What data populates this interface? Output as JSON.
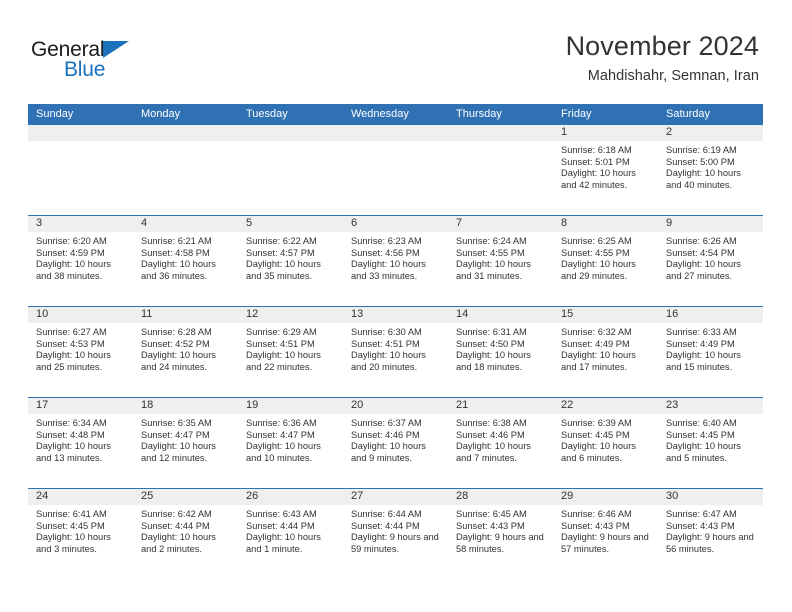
{
  "logo": {
    "word_top": "General",
    "word_bottom": "Blue",
    "triangle_color": "#1a72bd"
  },
  "header": {
    "title": "November 2024",
    "subtitle": "Mahdishahr, Semnan, Iran"
  },
  "theme": {
    "accent": "#3071b3",
    "day_band": "#efefef",
    "text": "#333333"
  },
  "weekdays": [
    "Sunday",
    "Monday",
    "Tuesday",
    "Wednesday",
    "Thursday",
    "Friday",
    "Saturday"
  ],
  "weeks": [
    [
      {
        "day": "",
        "empty": true
      },
      {
        "day": "",
        "empty": true
      },
      {
        "day": "",
        "empty": true
      },
      {
        "day": "",
        "empty": true
      },
      {
        "day": "",
        "empty": true
      },
      {
        "day": "1",
        "sunrise": "Sunrise: 6:18 AM",
        "sunset": "Sunset: 5:01 PM",
        "daylight": "Daylight: 10 hours and 42 minutes."
      },
      {
        "day": "2",
        "sunrise": "Sunrise: 6:19 AM",
        "sunset": "Sunset: 5:00 PM",
        "daylight": "Daylight: 10 hours and 40 minutes."
      }
    ],
    [
      {
        "day": "3",
        "sunrise": "Sunrise: 6:20 AM",
        "sunset": "Sunset: 4:59 PM",
        "daylight": "Daylight: 10 hours and 38 minutes."
      },
      {
        "day": "4",
        "sunrise": "Sunrise: 6:21 AM",
        "sunset": "Sunset: 4:58 PM",
        "daylight": "Daylight: 10 hours and 36 minutes."
      },
      {
        "day": "5",
        "sunrise": "Sunrise: 6:22 AM",
        "sunset": "Sunset: 4:57 PM",
        "daylight": "Daylight: 10 hours and 35 minutes."
      },
      {
        "day": "6",
        "sunrise": "Sunrise: 6:23 AM",
        "sunset": "Sunset: 4:56 PM",
        "daylight": "Daylight: 10 hours and 33 minutes."
      },
      {
        "day": "7",
        "sunrise": "Sunrise: 6:24 AM",
        "sunset": "Sunset: 4:55 PM",
        "daylight": "Daylight: 10 hours and 31 minutes."
      },
      {
        "day": "8",
        "sunrise": "Sunrise: 6:25 AM",
        "sunset": "Sunset: 4:55 PM",
        "daylight": "Daylight: 10 hours and 29 minutes."
      },
      {
        "day": "9",
        "sunrise": "Sunrise: 6:26 AM",
        "sunset": "Sunset: 4:54 PM",
        "daylight": "Daylight: 10 hours and 27 minutes."
      }
    ],
    [
      {
        "day": "10",
        "sunrise": "Sunrise: 6:27 AM",
        "sunset": "Sunset: 4:53 PM",
        "daylight": "Daylight: 10 hours and 25 minutes."
      },
      {
        "day": "11",
        "sunrise": "Sunrise: 6:28 AM",
        "sunset": "Sunset: 4:52 PM",
        "daylight": "Daylight: 10 hours and 24 minutes."
      },
      {
        "day": "12",
        "sunrise": "Sunrise: 6:29 AM",
        "sunset": "Sunset: 4:51 PM",
        "daylight": "Daylight: 10 hours and 22 minutes."
      },
      {
        "day": "13",
        "sunrise": "Sunrise: 6:30 AM",
        "sunset": "Sunset: 4:51 PM",
        "daylight": "Daylight: 10 hours and 20 minutes."
      },
      {
        "day": "14",
        "sunrise": "Sunrise: 6:31 AM",
        "sunset": "Sunset: 4:50 PM",
        "daylight": "Daylight: 10 hours and 18 minutes."
      },
      {
        "day": "15",
        "sunrise": "Sunrise: 6:32 AM",
        "sunset": "Sunset: 4:49 PM",
        "daylight": "Daylight: 10 hours and 17 minutes."
      },
      {
        "day": "16",
        "sunrise": "Sunrise: 6:33 AM",
        "sunset": "Sunset: 4:49 PM",
        "daylight": "Daylight: 10 hours and 15 minutes."
      }
    ],
    [
      {
        "day": "17",
        "sunrise": "Sunrise: 6:34 AM",
        "sunset": "Sunset: 4:48 PM",
        "daylight": "Daylight: 10 hours and 13 minutes."
      },
      {
        "day": "18",
        "sunrise": "Sunrise: 6:35 AM",
        "sunset": "Sunset: 4:47 PM",
        "daylight": "Daylight: 10 hours and 12 minutes."
      },
      {
        "day": "19",
        "sunrise": "Sunrise: 6:36 AM",
        "sunset": "Sunset: 4:47 PM",
        "daylight": "Daylight: 10 hours and 10 minutes."
      },
      {
        "day": "20",
        "sunrise": "Sunrise: 6:37 AM",
        "sunset": "Sunset: 4:46 PM",
        "daylight": "Daylight: 10 hours and 9 minutes."
      },
      {
        "day": "21",
        "sunrise": "Sunrise: 6:38 AM",
        "sunset": "Sunset: 4:46 PM",
        "daylight": "Daylight: 10 hours and 7 minutes."
      },
      {
        "day": "22",
        "sunrise": "Sunrise: 6:39 AM",
        "sunset": "Sunset: 4:45 PM",
        "daylight": "Daylight: 10 hours and 6 minutes."
      },
      {
        "day": "23",
        "sunrise": "Sunrise: 6:40 AM",
        "sunset": "Sunset: 4:45 PM",
        "daylight": "Daylight: 10 hours and 5 minutes."
      }
    ],
    [
      {
        "day": "24",
        "sunrise": "Sunrise: 6:41 AM",
        "sunset": "Sunset: 4:45 PM",
        "daylight": "Daylight: 10 hours and 3 minutes."
      },
      {
        "day": "25",
        "sunrise": "Sunrise: 6:42 AM",
        "sunset": "Sunset: 4:44 PM",
        "daylight": "Daylight: 10 hours and 2 minutes."
      },
      {
        "day": "26",
        "sunrise": "Sunrise: 6:43 AM",
        "sunset": "Sunset: 4:44 PM",
        "daylight": "Daylight: 10 hours and 1 minute."
      },
      {
        "day": "27",
        "sunrise": "Sunrise: 6:44 AM",
        "sunset": "Sunset: 4:44 PM",
        "daylight": "Daylight: 9 hours and 59 minutes."
      },
      {
        "day": "28",
        "sunrise": "Sunrise: 6:45 AM",
        "sunset": "Sunset: 4:43 PM",
        "daylight": "Daylight: 9 hours and 58 minutes."
      },
      {
        "day": "29",
        "sunrise": "Sunrise: 6:46 AM",
        "sunset": "Sunset: 4:43 PM",
        "daylight": "Daylight: 9 hours and 57 minutes."
      },
      {
        "day": "30",
        "sunrise": "Sunrise: 6:47 AM",
        "sunset": "Sunset: 4:43 PM",
        "daylight": "Daylight: 9 hours and 56 minutes."
      }
    ]
  ]
}
